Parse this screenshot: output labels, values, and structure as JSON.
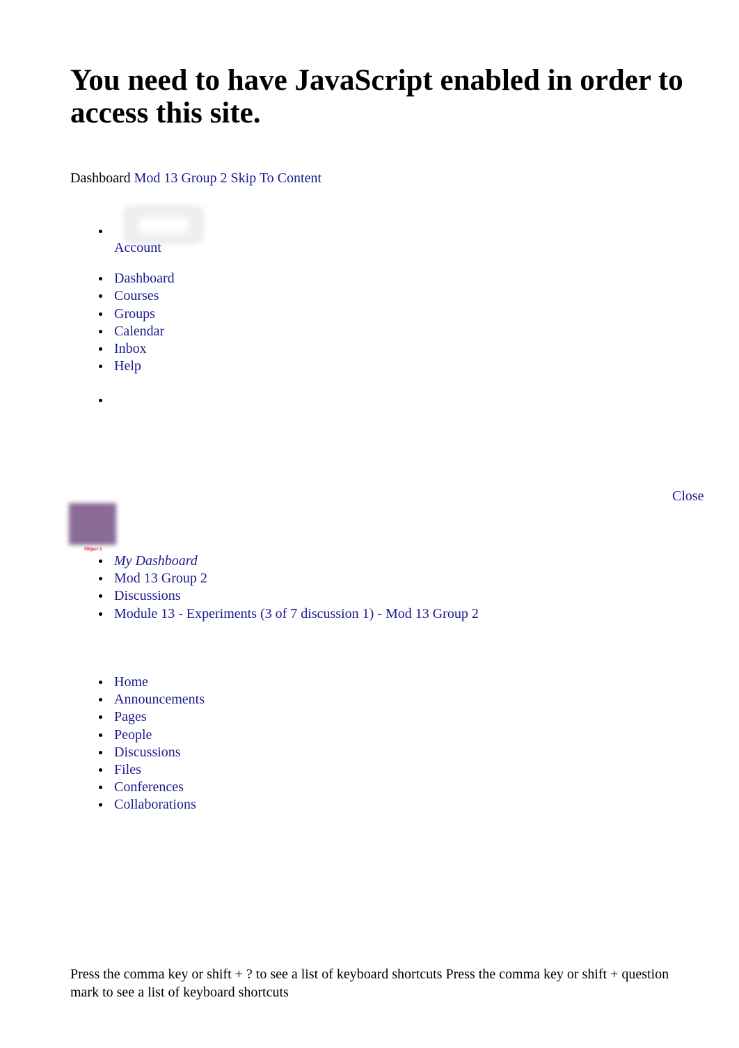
{
  "page": {
    "heading": "You need to have JavaScript enabled in order to access this site."
  },
  "topnav": {
    "dashboard_text": "Dashboard",
    "course_link": "Mod 13 Group 2",
    "skip_link": "Skip To Content"
  },
  "global_nav": {
    "avatar_icon": "broken-image-placeholder-icon",
    "items": [
      {
        "label": "Account"
      },
      {
        "label": "Dashboard"
      },
      {
        "label": "Courses"
      },
      {
        "label": "Groups"
      },
      {
        "label": "Calendar"
      },
      {
        "label": "Inbox"
      },
      {
        "label": "Help"
      },
      {
        "label": ""
      }
    ]
  },
  "tray": {
    "close_label": "Close"
  },
  "object_image": {
    "caption": "Object 1",
    "color": "#8a6a96"
  },
  "breadcrumb": {
    "items": [
      {
        "label": "My Dashboard",
        "italic": true
      },
      {
        "label": "Mod 13 Group 2",
        "italic": false
      },
      {
        "label": "Discussions",
        "italic": false
      },
      {
        "label": "Module 13 - Experiments (3 of 7 discussion 1) - Mod 13 Group 2",
        "italic": false
      }
    ]
  },
  "course_nav": {
    "items": [
      {
        "label": "Home"
      },
      {
        "label": "Announcements"
      },
      {
        "label": "Pages"
      },
      {
        "label": "People"
      },
      {
        "label": "Discussions"
      },
      {
        "label": "Files"
      },
      {
        "label": "Conferences"
      },
      {
        "label": "Collaborations"
      }
    ]
  },
  "footer": {
    "shortcuts_text": "Press the comma key or shift + ? to see a list of keyboard shortcuts Press the comma key or shift + question mark to see a list of keyboard shortcuts"
  },
  "colors": {
    "link": "#1a1a8e",
    "text": "#000000",
    "caption": "#d01010",
    "object": "#8a6a96",
    "background": "#ffffff"
  }
}
